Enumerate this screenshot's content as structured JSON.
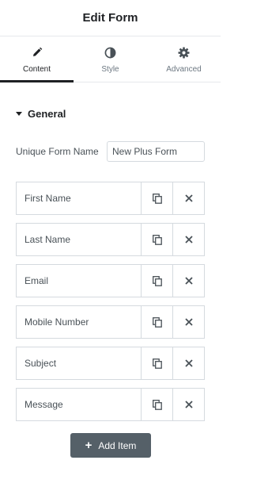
{
  "header": {
    "title": "Edit Form"
  },
  "tabs": [
    {
      "label": "Content",
      "icon": "pencil-icon",
      "active": true
    },
    {
      "label": "Style",
      "icon": "half-circle-icon",
      "active": false
    },
    {
      "label": "Advanced",
      "icon": "gear-icon",
      "active": false
    }
  ],
  "section": {
    "title": "General",
    "icon": "caret-down-icon"
  },
  "form_name": {
    "label": "Unique Form Name",
    "value": "New Plus Form"
  },
  "fields": [
    {
      "label": "First Name"
    },
    {
      "label": "Last Name"
    },
    {
      "label": "Email"
    },
    {
      "label": "Mobile Number"
    },
    {
      "label": "Subject"
    },
    {
      "label": "Message"
    }
  ],
  "add_button": {
    "label": "Add Item",
    "icon": "plus-icon"
  },
  "colors": {
    "accent": "#1f2124",
    "button_bg": "#556068",
    "border": "#d5dadf",
    "text": "#495157"
  }
}
